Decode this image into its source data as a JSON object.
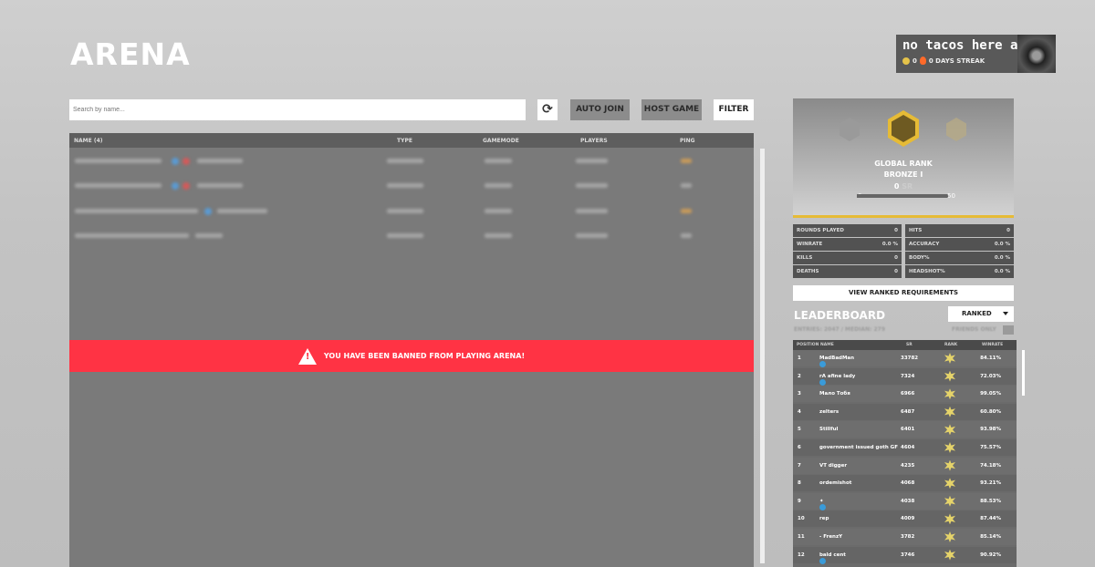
{
  "header": {
    "title": "ARENA"
  },
  "profile": {
    "name": "no tacos here ami",
    "coins": "0",
    "streak": "0 DAYS STREAK"
  },
  "toolbar": {
    "search_placeholder": "Search by name...",
    "refresh_icon": "⟳",
    "auto_join": "AUTO JOIN",
    "host_game": "HOST GAME",
    "filter": "FILTER"
  },
  "servers": {
    "columns": {
      "name": "NAME (4)",
      "type": "TYPE",
      "gamemode": "GAMEMODE",
      "players": "PLAYERS",
      "ping": "PING"
    }
  },
  "ban": {
    "message": "YOU HAVE BEEN BANNED FROM PLAYING ARENA!"
  },
  "rank": {
    "label": "GLOBAL RANK",
    "tier": "BRONZE I",
    "sr": "0",
    "sr_unit": "SR",
    "min": "0",
    "max": "50",
    "progress": 0.0,
    "accent": "#e6bb36"
  },
  "stats": {
    "rounds_played": {
      "label": "ROUNDS PLAYED",
      "value": "0"
    },
    "winrate": {
      "label": "WINRATE",
      "value": "0.0 %"
    },
    "kills": {
      "label": "KILLS",
      "value": "0"
    },
    "deaths": {
      "label": "DEATHS",
      "value": "0"
    },
    "hits": {
      "label": "HITS",
      "value": "0"
    },
    "accuracy": {
      "label": "ACCURACY",
      "value": "0.0 %"
    },
    "body": {
      "label": "BODY%",
      "value": "0.0 %"
    },
    "headshot": {
      "label": "HEADSHOT%",
      "value": "0.0 %"
    }
  },
  "view_ranked": "VIEW RANKED REQUIREMENTS",
  "leaderboard": {
    "title": "LEADERBOARD",
    "mode": "RANKED",
    "entries_text": "ENTRIES: 2047 / MEDIAN: 279",
    "friends_only": "FRIENDS ONLY",
    "columns": {
      "position": "POSITION",
      "name": "NAME",
      "sr": "SR",
      "rank": "RANK",
      "winrate": "WINRATE"
    },
    "rows": [
      {
        "pos": "1",
        "name": "MadBadMan",
        "sr": "33782",
        "winrate": "84.11%",
        "verified": true
      },
      {
        "pos": "2",
        "name": "rA afine lady",
        "sr": "7324",
        "winrate": "72.03%",
        "verified": true
      },
      {
        "pos": "3",
        "name": "Мало Тобя",
        "sr": "6966",
        "winrate": "99.05%",
        "verified": false
      },
      {
        "pos": "4",
        "name": "zelters",
        "sr": "6487",
        "winrate": "60.80%",
        "verified": false
      },
      {
        "pos": "5",
        "name": "Stillful",
        "sr": "6401",
        "winrate": "93.98%",
        "verified": false
      },
      {
        "pos": "6",
        "name": "government issued goth GF",
        "sr": "4604",
        "winrate": "75.57%",
        "verified": false
      },
      {
        "pos": "7",
        "name": "VT digger",
        "sr": "4235",
        "winrate": "74.18%",
        "verified": false
      },
      {
        "pos": "8",
        "name": "ordemishot",
        "sr": "4068",
        "winrate": "93.21%",
        "verified": false
      },
      {
        "pos": "9",
        "name": "✦",
        "sr": "4038",
        "winrate": "88.53%",
        "verified": true
      },
      {
        "pos": "10",
        "name": "rep",
        "sr": "4009",
        "winrate": "87.44%",
        "verified": false
      },
      {
        "pos": "11",
        "name": "- FrenzY",
        "sr": "3782",
        "winrate": "85.14%",
        "verified": false
      },
      {
        "pos": "12",
        "name": "bald cent",
        "sr": "3746",
        "winrate": "90.92%",
        "verified": true
      }
    ]
  }
}
